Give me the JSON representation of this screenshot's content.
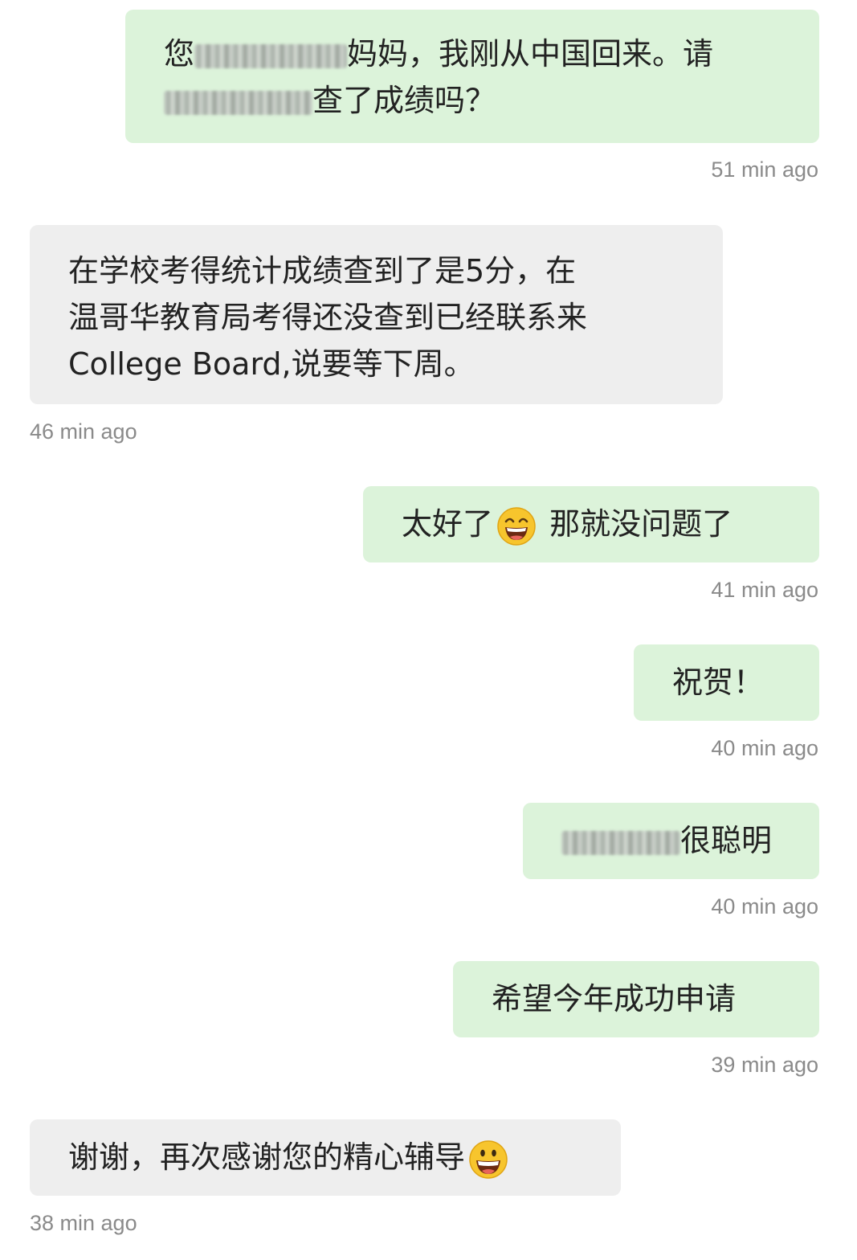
{
  "messages": [
    {
      "from": "me",
      "line1_prefix": "您",
      "line1_suffix": "妈妈，我刚从中国回来。请",
      "line2_suffix": "查了成绩吗？",
      "time": "51 min ago"
    },
    {
      "from": "other",
      "line1": "在学校考得统计成绩查到了是5分，在",
      "line2": "温哥华教育局考得还没查到已经联系来",
      "line3": "College Board,说要等下周。",
      "time": "46 min ago"
    },
    {
      "from": "me",
      "text_before": "太好了",
      "emoji": "grinning-squinting-face-icon",
      "text_after": " 那就没问题了",
      "time": "41 min ago"
    },
    {
      "from": "me",
      "text": "祝贺！",
      "time": "40 min ago"
    },
    {
      "from": "me",
      "text_suffix": "很聪明",
      "time": "40 min ago"
    },
    {
      "from": "me",
      "text": "希望今年成功申请",
      "time": "39 min ago"
    },
    {
      "from": "other",
      "text_before": "谢谢，再次感谢您的精心辅导",
      "emoji": "grinning-face-icon",
      "time": "38 min ago"
    }
  ],
  "colors": {
    "sent_bubble": "#dcf3da",
    "received_bubble": "#eeeeee",
    "timestamp": "#8a8a8a",
    "text": "#222222"
  }
}
